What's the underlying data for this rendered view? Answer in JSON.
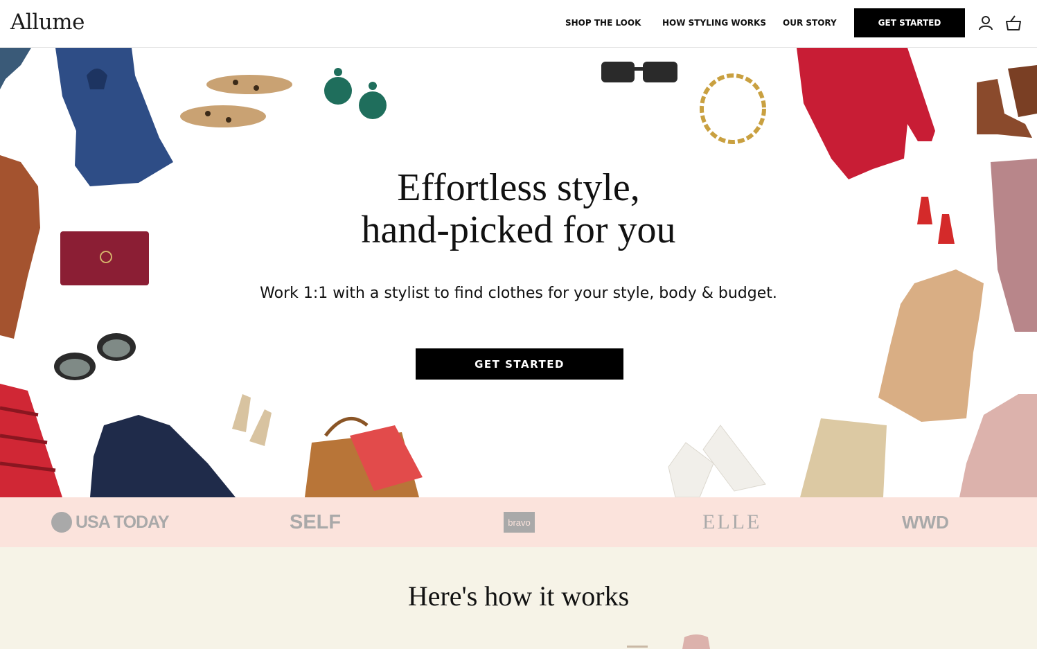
{
  "header": {
    "logo": "Allume",
    "nav": [
      {
        "label": "SHOP THE LOOK"
      },
      {
        "label": "HOW STYLING WORKS"
      },
      {
        "label": "OUR STORY"
      }
    ],
    "cta_label": "GET STARTED",
    "icons": [
      "account-icon",
      "basket-icon"
    ]
  },
  "hero": {
    "title_line1": "Effortless style,",
    "title_line2": "hand-picked for you",
    "subtitle": "Work 1:1 with a stylist to find clothes for your style, body & budget.",
    "cta_label": "GET STARTED"
  },
  "press": {
    "logos": [
      "USA TODAY",
      "SELF",
      "bravo",
      "ELLE",
      "WWD"
    ]
  },
  "how": {
    "title": "Here's how it works"
  },
  "colors": {
    "black": "#000000",
    "press_band": "#fbe3dc",
    "how_band": "#f6f3e7",
    "press_logo_gray": "#a9a9a9"
  }
}
